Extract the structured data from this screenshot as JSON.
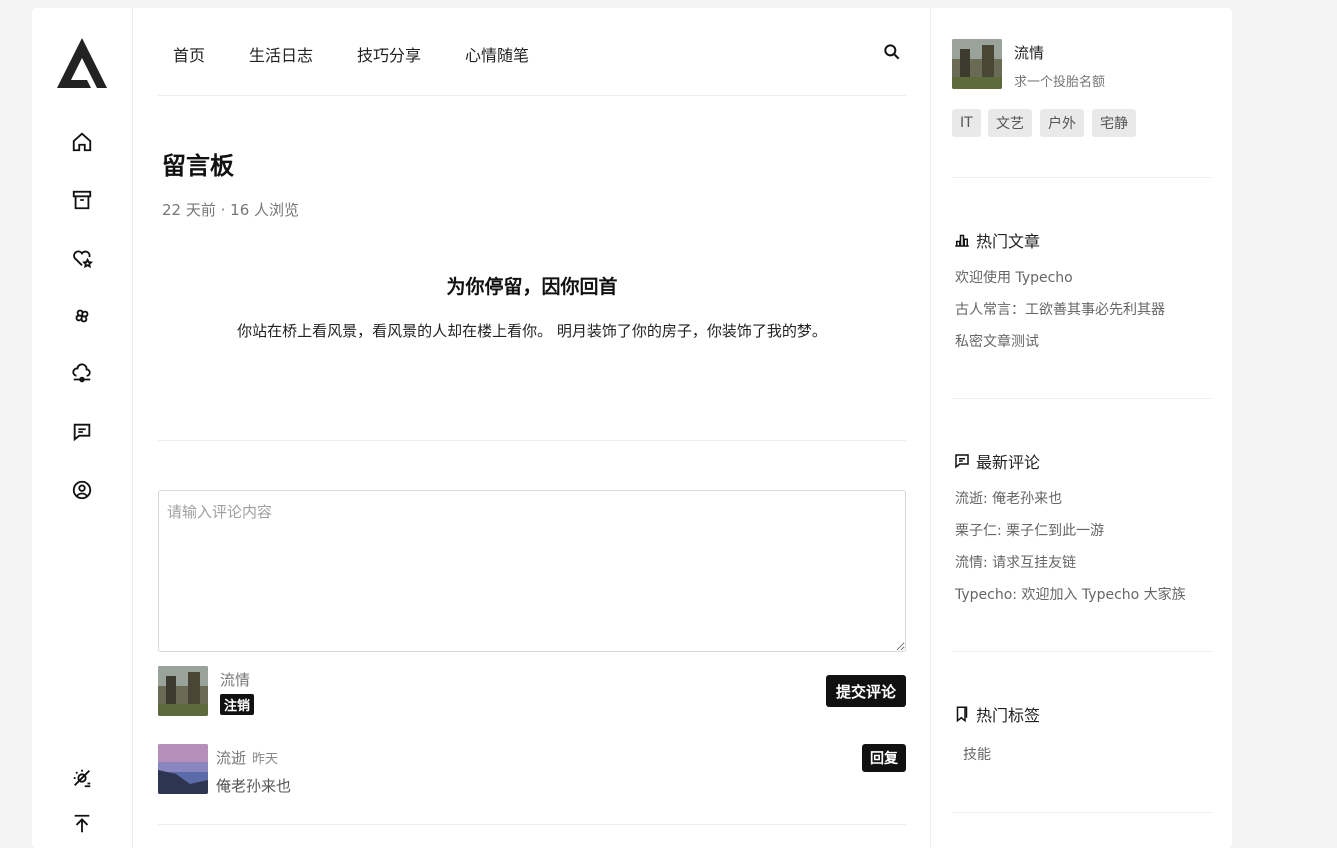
{
  "nav": {
    "items": [
      "首页",
      "生活日志",
      "技巧分享",
      "心情随笔"
    ]
  },
  "page": {
    "title": "留言板",
    "meta": "22 天前 · 16 人浏览",
    "heading": "为你停留，因你回首",
    "text": "你站在桥上看风景，看风景的人却在楼上看你。 明月装饰了你的房子，你装饰了我的梦。"
  },
  "comment_form": {
    "placeholder": "请输入评论内容",
    "user_name": "流情",
    "logout_label": "注销",
    "submit_label": "提交评论"
  },
  "comments": [
    {
      "author": "流逝",
      "time": "昨天",
      "text": "俺老孙来也",
      "reply_label": "回复"
    }
  ],
  "profile": {
    "name": "流情",
    "motto": "求一个投胎名额",
    "tags": [
      "IT",
      "文艺",
      "户外",
      "宅静"
    ]
  },
  "hot_posts": {
    "title": "热门文章",
    "items": [
      "欢迎使用 Typecho",
      "古人常言：工欲善其事必先利其器",
      "私密文章测试"
    ]
  },
  "recent_comments": {
    "title": "最新评论",
    "items": [
      "流逝: 俺老孙来也",
      "栗子仁: 栗子仁到此一游",
      "流情: 请求互挂友链",
      "Typecho: 欢迎加入 Typecho 大家族"
    ]
  },
  "hot_tags": {
    "title": "热门标签",
    "items": [
      "技能"
    ]
  },
  "icons": {
    "rail": [
      "home-icon",
      "archive-icon",
      "heart-star-icon",
      "pinwheel-icon",
      "cloud-upload-icon",
      "message-icon",
      "user-circle-icon",
      "theme-toggle-icon",
      "back-to-top-icon"
    ]
  },
  "colors": {
    "accent": "#111111",
    "background": "#f4f4f4",
    "card": "#ffffff"
  }
}
